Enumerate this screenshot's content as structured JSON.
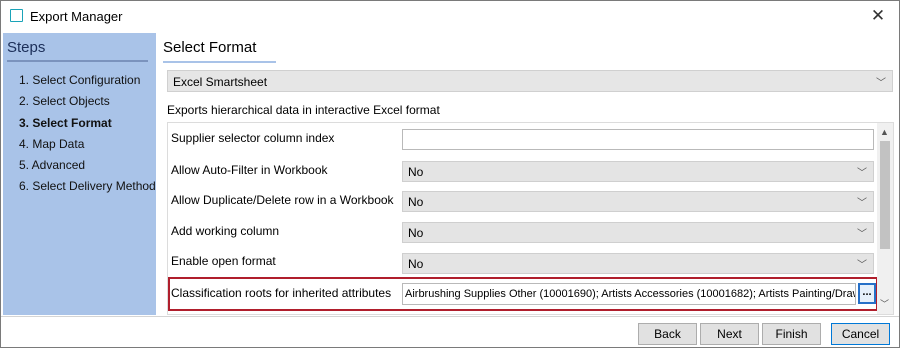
{
  "window": {
    "title": "Export Manager"
  },
  "steps": {
    "heading": "Steps",
    "items": [
      {
        "label": "1. Select Configuration"
      },
      {
        "label": "2. Select Objects"
      },
      {
        "label": "3. Select Format"
      },
      {
        "label": "4. Map Data"
      },
      {
        "label": "5. Advanced"
      },
      {
        "label": "6. Select Delivery Method"
      }
    ],
    "active_index": 2
  },
  "main": {
    "section_title": "Select Format",
    "format_value": "Excel Smartsheet",
    "description": "Exports hierarchical data in interactive Excel format",
    "properties": [
      {
        "label": "Supplier selector column index",
        "value": ""
      },
      {
        "label": "Allow Auto-Filter in Workbook",
        "value": "No"
      },
      {
        "label": "Allow Duplicate/Delete row in a Workbook",
        "value": "No"
      },
      {
        "label": "Add working column",
        "value": "No"
      },
      {
        "label": "Enable open format",
        "value": "No"
      }
    ],
    "classification": {
      "label": "Classification roots for inherited attributes",
      "value": "Airbrushing Supplies Other (10001690); Artists Accessories (10001682); Artists Painting/Drawing Supplies",
      "browse_label": "..."
    }
  },
  "footer": {
    "back": "Back",
    "next": "Next",
    "finish": "Finish",
    "cancel": "Cancel"
  }
}
